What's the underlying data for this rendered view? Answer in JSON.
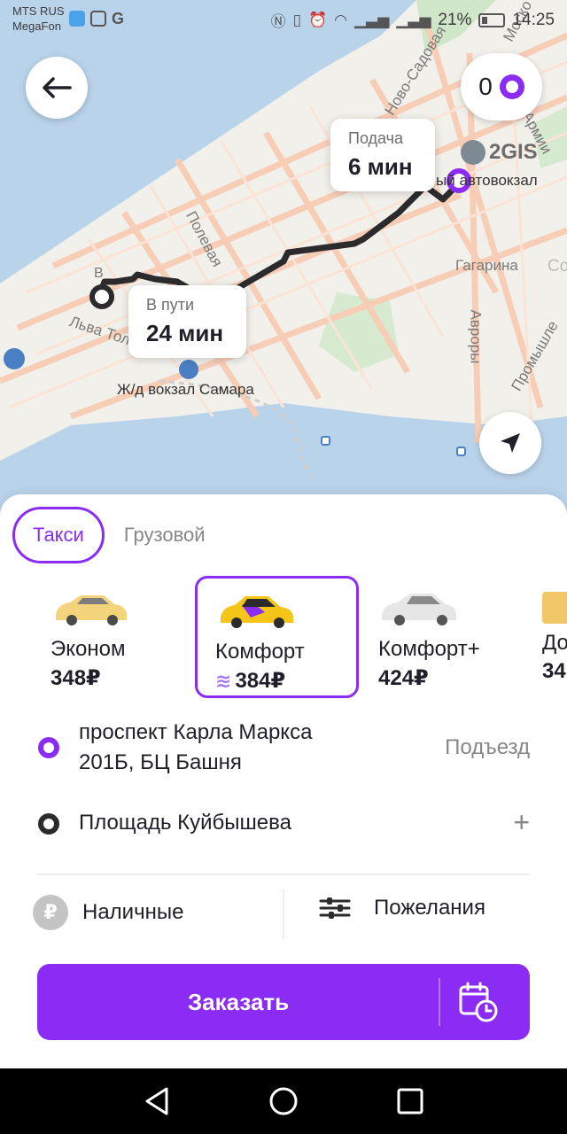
{
  "status_bar": {
    "carrier_1": "MTS RUS",
    "carrier_2": "MegaFon",
    "g_icon": "G",
    "battery_percent": "21%",
    "time": "14:25"
  },
  "map": {
    "points_count": "0",
    "pickup_bubble": {
      "label": "Подача",
      "value": "6 мин"
    },
    "transit_bubble": {
      "label": "В пути",
      "value": "24 мин"
    },
    "gis_logo": "2GIS",
    "labels": {
      "novo_sadovaya": "Ново-Садовая",
      "novo": "Ново-",
      "moskov": "Моско",
      "armii": "Армии",
      "bus_station": "ый автовокзал",
      "polevaya": "Полевая",
      "gagarina": "Гагарина",
      "so": "Со",
      "l_va_tolstogo": "Льва Толстого",
      "avrory": "Авроры",
      "promyshl": "Промышле",
      "railway_station": "Ж/д вокзал Самара",
      "v": "В"
    },
    "accent_color": "#8a2cf3",
    "route_color": "#2b2b2e"
  },
  "sheet": {
    "tabs": [
      {
        "label": "Такси",
        "active": true
      },
      {
        "label": "Грузовой",
        "active": false
      }
    ],
    "tariffs": [
      {
        "name": "Эконом",
        "price": "348₽",
        "car_color": "#f3d47a",
        "selected": false
      },
      {
        "name": "Комфорт",
        "price": "384₽",
        "car_color": "#f5c518",
        "selected": true,
        "boosted": true
      },
      {
        "name": "Комфорт+",
        "price": "424₽",
        "car_color": "#dcdcdc",
        "selected": false
      },
      {
        "name": "До",
        "price": "34",
        "car_color": "#f0c86a",
        "selected": false
      }
    ],
    "route": {
      "from": {
        "line1": "проспект Карла Маркса",
        "line2": "201Б, БЦ Башня",
        "aside": "Подъезд"
      },
      "to": {
        "line1": "Площадь Куйбышева",
        "aside": "+"
      }
    },
    "payment": {
      "icon_text": "₽",
      "label": "Наличные"
    },
    "wishes": {
      "label": "Пожелания"
    },
    "order_button": {
      "label": "Заказать"
    }
  }
}
